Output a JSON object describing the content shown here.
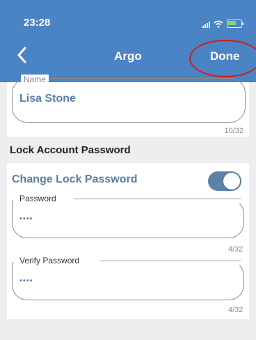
{
  "status": {
    "time": "23:28"
  },
  "nav": {
    "title": "Argo",
    "done_label": "Done"
  },
  "name_field": {
    "label": "Name",
    "value": "Lisa Stone",
    "counter": "10/32"
  },
  "section": {
    "title": "Lock Account Password"
  },
  "lock": {
    "change_label": "Change Lock Password",
    "toggle_on": true,
    "password": {
      "label": "Password",
      "value": "••••",
      "counter": "4/32"
    },
    "verify": {
      "label": "Verify Password",
      "value": "••••",
      "counter": "4/32"
    }
  },
  "colors": {
    "header": "#4a84c4",
    "accent_text": "#5a7ea2",
    "toggle": "#5d82a5",
    "annotation": "#d01c24"
  }
}
